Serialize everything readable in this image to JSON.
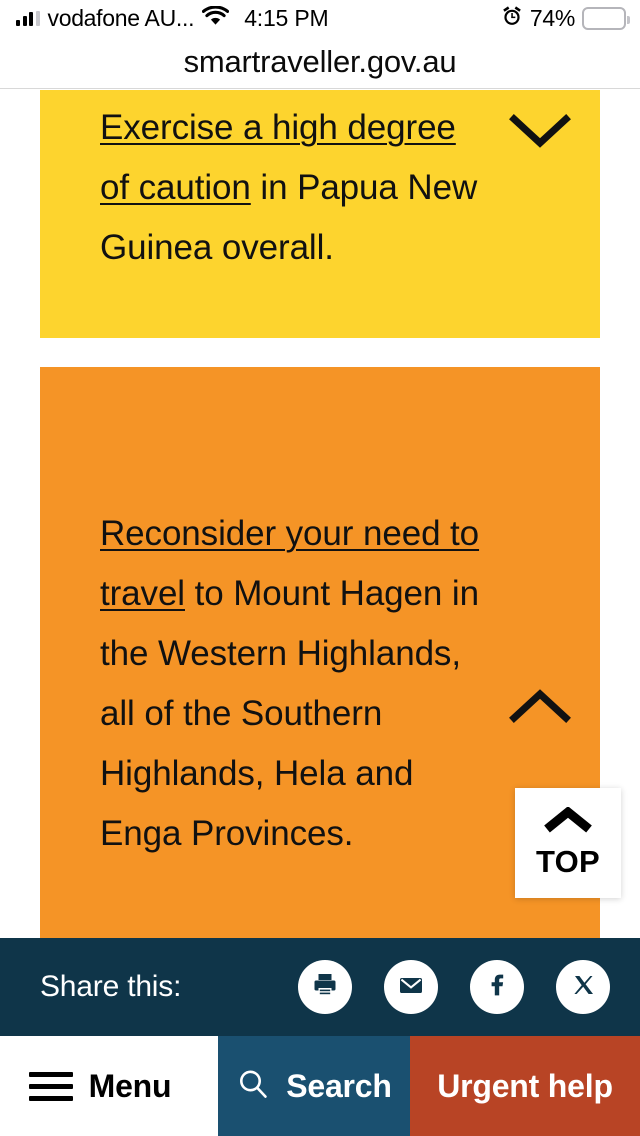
{
  "status_bar": {
    "carrier": "vodafone AU...",
    "time": "4:15 PM",
    "battery_percent": "74%",
    "battery_level": 74,
    "signal_icon": "cellular-bars-icon",
    "wifi_icon": "wifi-icon",
    "alarm_icon": "alarm-clock-icon",
    "battery_icon": "battery-icon",
    "battery_color": "#ffcc00"
  },
  "browser": {
    "url": "smartraveller.gov.au"
  },
  "advisories": [
    {
      "level": "high-caution",
      "color": "#fdd42e",
      "link_text": "Exercise a high degree of caution",
      "rest_text": " in Papua New Guinea overall.",
      "expanded": false,
      "chevron": "chevron-down-icon"
    },
    {
      "level": "reconsider-travel",
      "color": "#f59426",
      "link_text": "Reconsider your need to travel",
      "rest_text": " to Mount Hagen in the Western Highlands, all of the Southern Highlands, Hela and Enga Provinces.",
      "expanded": true,
      "chevron": "chevron-up-icon"
    }
  ],
  "back_to_top": {
    "label": "TOP",
    "icon": "chevron-up-icon"
  },
  "share": {
    "label": "Share this:",
    "background": "#0f3549",
    "items": [
      {
        "name": "print",
        "icon": "printer-icon"
      },
      {
        "name": "email",
        "icon": "envelope-icon"
      },
      {
        "name": "facebook",
        "icon": "facebook-icon"
      },
      {
        "name": "twitter-x",
        "icon": "x-twitter-icon"
      }
    ]
  },
  "bottom_nav": [
    {
      "label": "Menu",
      "icon": "hamburger-icon",
      "background": "#ffffff",
      "text_color": "#000000"
    },
    {
      "label": "Search",
      "icon": "search-icon",
      "background": "#1a5070",
      "text_color": "#ffffff"
    },
    {
      "label": "Urgent help",
      "icon": "none",
      "background": "#b84425",
      "text_color": "#ffffff"
    }
  ]
}
